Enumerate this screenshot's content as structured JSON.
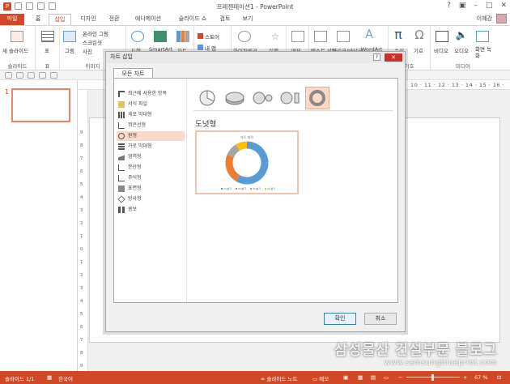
{
  "window": {
    "title": "프레젠테이션1 - PowerPoint",
    "minimize": "–",
    "restore": "□",
    "close": "✕"
  },
  "tabs": [
    {
      "label": "파일"
    },
    {
      "label": "홈"
    },
    {
      "label": "삽입"
    },
    {
      "label": "디자인"
    },
    {
      "label": "전환"
    },
    {
      "label": "애니메이션"
    },
    {
      "label": "슬라이드 쇼"
    },
    {
      "label": "검토"
    },
    {
      "label": "보기"
    }
  ],
  "user": {
    "name": "이혜강"
  },
  "ribbon": {
    "new_slide": "새 슬라이드",
    "table": "표",
    "images": "그림",
    "online_pictures": "온라인 그림",
    "screenshot": "스크린샷",
    "photo_album": "사진",
    "shapes": "도형",
    "smartart": "SmartArt",
    "chart": "차트",
    "store": "스토어",
    "my_addins": "내 앱",
    "hyperlink": "하이퍼링크",
    "action": "실행",
    "comment": "메모",
    "textbox": "텍스트 상자",
    "header_footer": "머리글/바닥글",
    "wordart": "WordArt",
    "equation": "수식",
    "symbol": "기호",
    "video": "비디오",
    "audio": "오디오",
    "screen_recording": "화면 녹화",
    "group_slides": "슬라이드",
    "group_table": "표",
    "group_images": "이미지",
    "group_symbols": "기호",
    "group_media": "미디어"
  },
  "slides": {
    "current_number": "1"
  },
  "ruler": {
    "h_ticks": "10 · 11 · 12 · 13 · 14 · 15 · 16 ·",
    "v_ticks": [
      "9",
      "8",
      "7",
      "6",
      "5",
      "4",
      "3",
      "2",
      "1",
      "0",
      "1",
      "2",
      "3",
      "4",
      "5",
      "6",
      "7",
      "8",
      "9"
    ]
  },
  "dialog": {
    "title": "차트 삽입",
    "help": "?",
    "close": "✕",
    "tab_all_charts": "모든 차트",
    "categories": [
      {
        "label": "최근에 사용한 항목",
        "icon": "recent-icon",
        "selected": false
      },
      {
        "label": "서식 파일",
        "icon": "folder-icon",
        "selected": false
      },
      {
        "label": "세로 막대형",
        "icon": "column-chart-icon",
        "selected": false
      },
      {
        "label": "꺾은선형",
        "icon": "line-chart-icon",
        "selected": false
      },
      {
        "label": "원형",
        "icon": "pie-chart-icon",
        "selected": true
      },
      {
        "label": "가로 막대형",
        "icon": "bar-chart-icon",
        "selected": false
      },
      {
        "label": "영역형",
        "icon": "area-chart-icon",
        "selected": false
      },
      {
        "label": "분산형",
        "icon": "scatter-chart-icon",
        "selected": false
      },
      {
        "label": "주식형",
        "icon": "stock-chart-icon",
        "selected": false
      },
      {
        "label": "표면형",
        "icon": "surface-chart-icon",
        "selected": false
      },
      {
        "label": "방사형",
        "icon": "radar-chart-icon",
        "selected": false
      },
      {
        "label": "콤보",
        "icon": "combo-chart-icon",
        "selected": false
      }
    ],
    "subtypes": [
      {
        "icon": "pie-icon",
        "selected": false
      },
      {
        "icon": "3d-pie-icon",
        "selected": false
      },
      {
        "icon": "pie-of-pie-icon",
        "selected": false
      },
      {
        "icon": "bar-of-pie-icon",
        "selected": false
      },
      {
        "icon": "doughnut-icon",
        "selected": true
      }
    ],
    "selected_heading": "도넛형",
    "preview": {
      "chart_title": "차트 제목",
      "legend": [
        "1사분기",
        "2사분기",
        "3사분기",
        "4사분기"
      ],
      "colors": [
        "#5b9bd5",
        "#ed7d31",
        "#a5a5a5",
        "#ffc000"
      ],
      "values": [
        8.2,
        3.2,
        1.4,
        1.2
      ]
    },
    "ok": "확인",
    "cancel": "취소"
  },
  "status": {
    "slide_info": "슬라이드 1/1",
    "language": "한국어",
    "notes": "슬라이드 노트",
    "comments": "메모",
    "zoom_minus": "−",
    "zoom_plus": "+",
    "zoom": "67 %"
  },
  "watermark": {
    "text": "삼성물산 건설부문 블로그",
    "url": "www.samsungblueprint.com"
  }
}
